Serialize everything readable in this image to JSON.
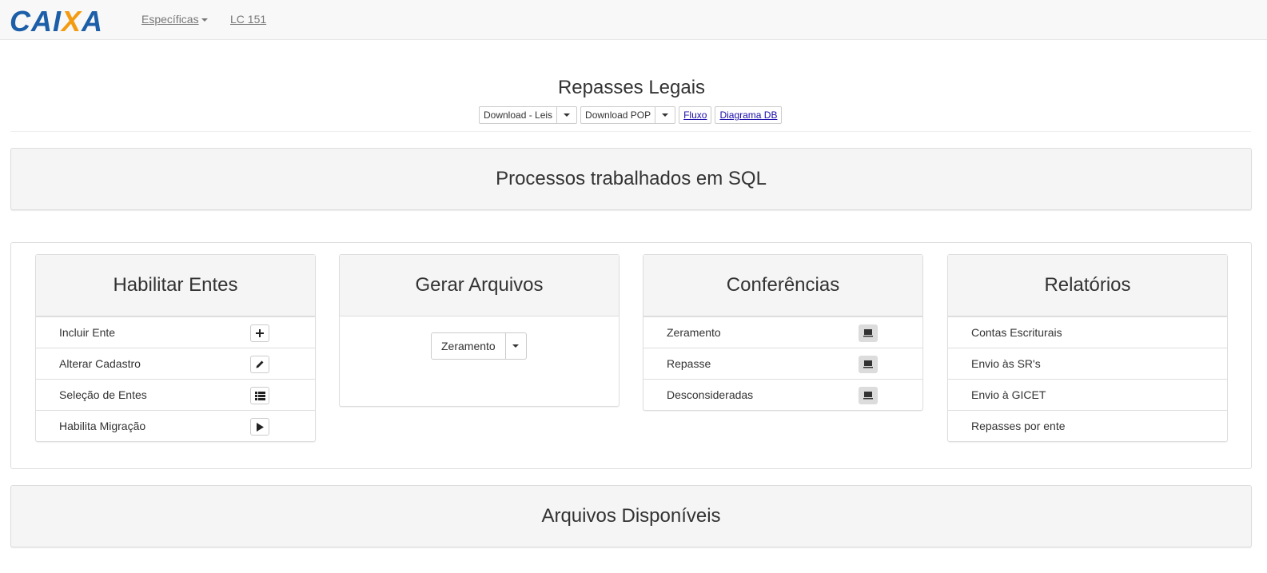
{
  "navbar": {
    "logo_text": "CAIXA",
    "items": [
      {
        "label": "Específicas",
        "has_caret": true
      },
      {
        "label": "LC 151"
      }
    ]
  },
  "header": {
    "title": "Repasses Legais",
    "buttons": {
      "download_leis": "Download - Leis",
      "download_pop": "Download POP",
      "fluxo": "Fluxo",
      "diagrama_db": "Diagrama DB"
    }
  },
  "sections": {
    "sql": "Processos trabalhados em SQL",
    "arquivos": "Arquivos Disponíveis"
  },
  "panels": {
    "habilitar": {
      "title": "Habilitar Entes",
      "rows": [
        {
          "label": "Incluir Ente",
          "icon": "plus-icon"
        },
        {
          "label": "Alterar Cadastro",
          "icon": "pencil-icon"
        },
        {
          "label": "Seleção de Entes",
          "icon": "list-icon"
        },
        {
          "label": "Habilita Migração",
          "icon": "play-icon"
        }
      ]
    },
    "gerar": {
      "title": "Gerar Arquivos",
      "dropdown_label": "Zeramento"
    },
    "conferencias": {
      "title": "Conferências",
      "rows": [
        {
          "label": "Zeramento",
          "icon": "monitor-icon"
        },
        {
          "label": "Repasse",
          "icon": "monitor-icon"
        },
        {
          "label": "Desconsideradas",
          "icon": "monitor-icon"
        }
      ]
    },
    "relatorios": {
      "title": "Relatórios",
      "rows": [
        {
          "label": "Contas Escriturais"
        },
        {
          "label": "Envio às SR's"
        },
        {
          "label": "Envio à GICET"
        },
        {
          "label": "Repasses por ente"
        }
      ]
    }
  },
  "colors": {
    "logo_blue": "#1c5fa8",
    "logo_orange": "#f39c12",
    "link_blue": "#1a0dab"
  }
}
